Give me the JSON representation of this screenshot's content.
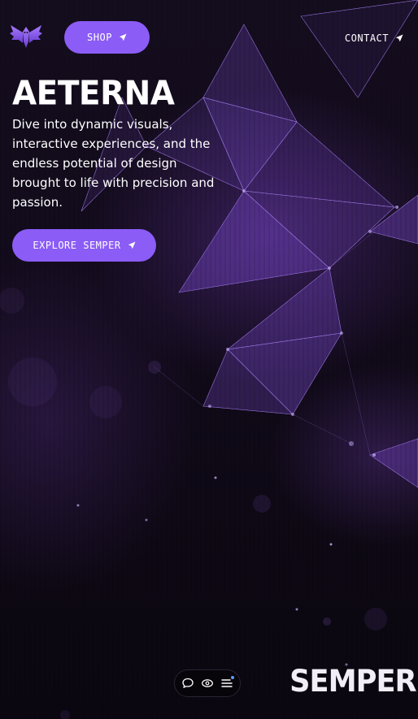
{
  "header": {
    "shop_label": "SHOP",
    "contact_label": "CONTACT",
    "logo_icon": "winged-emblem-icon"
  },
  "hero": {
    "title": "AETERNA",
    "tagline": "Dive into dynamic visuals, interactive experiences, and the endless potential of design brought to life with precision and passion.",
    "cta_label": "EXPLORE SEMPER"
  },
  "toolbar": {
    "icons": [
      "chat-bubble-icon",
      "eye-icon",
      "menu-icon"
    ]
  },
  "footer": {
    "wordmark": "SEMPER"
  },
  "colors": {
    "accent": "#8b5cf6",
    "background": "#0b0710",
    "text": "#ffffff",
    "notification": "#5b9bff"
  }
}
